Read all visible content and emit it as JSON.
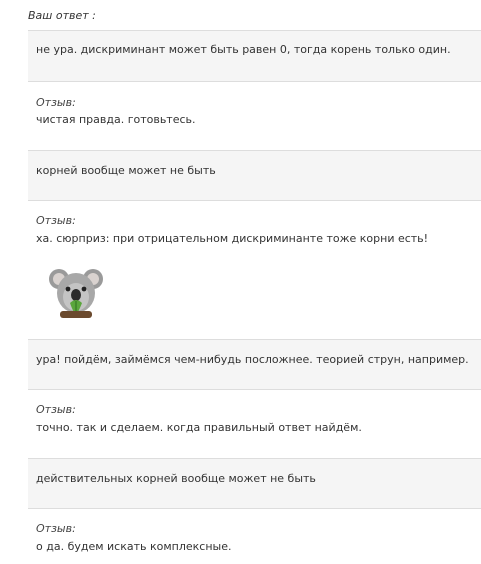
{
  "header": "Ваш ответ :",
  "feedback_label": "Отзыв:",
  "answers": [
    {
      "text": "не ура. дискриминант может быть равен 0, тогда корень только один.",
      "feedback": "чистая правда. готовьтесь."
    },
    {
      "text": "корней вообще может не быть",
      "feedback": "ха. сюрприз: при отрицательном дискриминанте тоже корни есть!",
      "sticker": "koala-sticker"
    },
    {
      "text": "ура! пойдём, займёмся чем-нибудь посложнее. теорией струн, например.",
      "feedback": "точно. так и сделаем. когда правильный ответ найдём."
    },
    {
      "text": "действительных корней вообще может не быть",
      "feedback": "о да. будем искать комплексные."
    }
  ]
}
